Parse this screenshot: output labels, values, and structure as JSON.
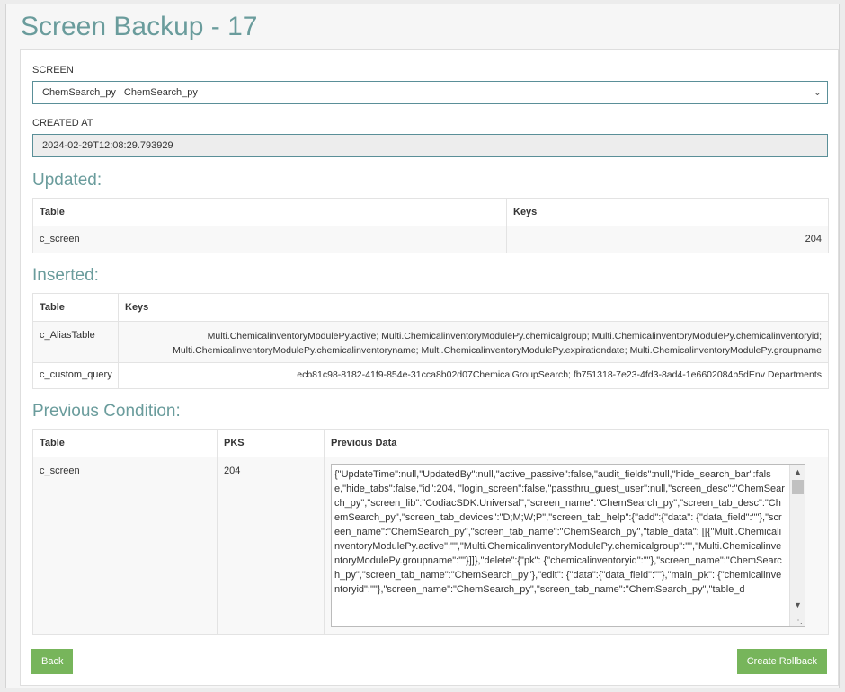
{
  "page": {
    "title": "Screen Backup - 17"
  },
  "form": {
    "screen_label": "SCREEN",
    "screen_value": "ChemSearch_py | ChemSearch_py",
    "created_at_label": "CREATED AT",
    "created_at_value": "2024-02-29T12:08:29.793929"
  },
  "updated": {
    "title": "Updated:",
    "headers": [
      "Table",
      "Keys"
    ],
    "rows": [
      {
        "table": "c_screen",
        "keys": "204"
      }
    ]
  },
  "inserted": {
    "title": "Inserted:",
    "headers": [
      "Table",
      "Keys"
    ],
    "rows": [
      {
        "table": "c_AliasTable",
        "keys_line1": "Multi.ChemicalinventoryModulePy.active; Multi.ChemicalinventoryModulePy.chemicalgroup; Multi.ChemicalinventoryModulePy.chemicalinventoryid;",
        "keys_line2": "Multi.ChemicalinventoryModulePy.chemicalinventoryname; Multi.ChemicalinventoryModulePy.expirationdate; Multi.ChemicalinventoryModulePy.groupname"
      },
      {
        "table": "c_custom_query",
        "keys_line1": "ecb81c98-8182-41f9-854e-31cca8b02d07ChemicalGroupSearch; fb751318-7e23-4fd3-8ad4-1e6602084b5dEnv Departments"
      }
    ]
  },
  "previous": {
    "title": "Previous Condition:",
    "headers": [
      "Table",
      "PKS",
      "Previous Data"
    ],
    "rows": [
      {
        "table": "c_screen",
        "pks": "204",
        "data": "{\"UpdateTime\":null,\"UpdatedBy\":null,\"active_passive\":false,\"audit_fields\":null,\"hide_search_bar\":false,\"hide_tabs\":false,\"id\":204, \"login_screen\":false,\"passthru_guest_user\":null,\"screen_desc\":\"ChemSearch_py\",\"screen_lib\":\"CodiacSDK.Universal\",\"screen_name\":\"ChemSearch_py\",\"screen_tab_desc\":\"ChemSearch_py\",\"screen_tab_devices\":\"D;M;W;P\",\"screen_tab_help\":{\"add\":{\"data\": {\"data_field\":\"\"},\"screen_name\":\"ChemSearch_py\",\"screen_tab_name\":\"ChemSearch_py\",\"table_data\": [[{\"Multi.ChemicalinventoryModulePy.active\":\"\",\"Multi.ChemicalinventoryModulePy.chemicalgroup\":\"\",\"Multi.ChemicalinventoryModulePy.groupname\":\"\"}]]},\"delete\":{\"pk\": {\"chemicalinventoryid\":\"\"},\"screen_name\":\"ChemSearch_py\",\"screen_tab_name\":\"ChemSearch_py\"},\"edit\": {\"data\":{\"data_field\":\"\"},\"main_pk\": {\"chemicalinventoryid\":\"\"},\"screen_name\":\"ChemSearch_py\",\"screen_tab_name\":\"ChemSearch_py\",\"table_d"
      }
    ]
  },
  "buttons": {
    "back": "Back",
    "rollback": "Create Rollback"
  },
  "icons": {
    "select_chevron": "chevron-down-icon",
    "scroll_up": "chevron-up-icon",
    "scroll_down": "chevron-down-icon",
    "resize": "resize-grip-icon"
  },
  "colors": {
    "accent_title": "#6a9c9c",
    "button_green": "#77b55b",
    "input_border": "#5a8f98"
  }
}
